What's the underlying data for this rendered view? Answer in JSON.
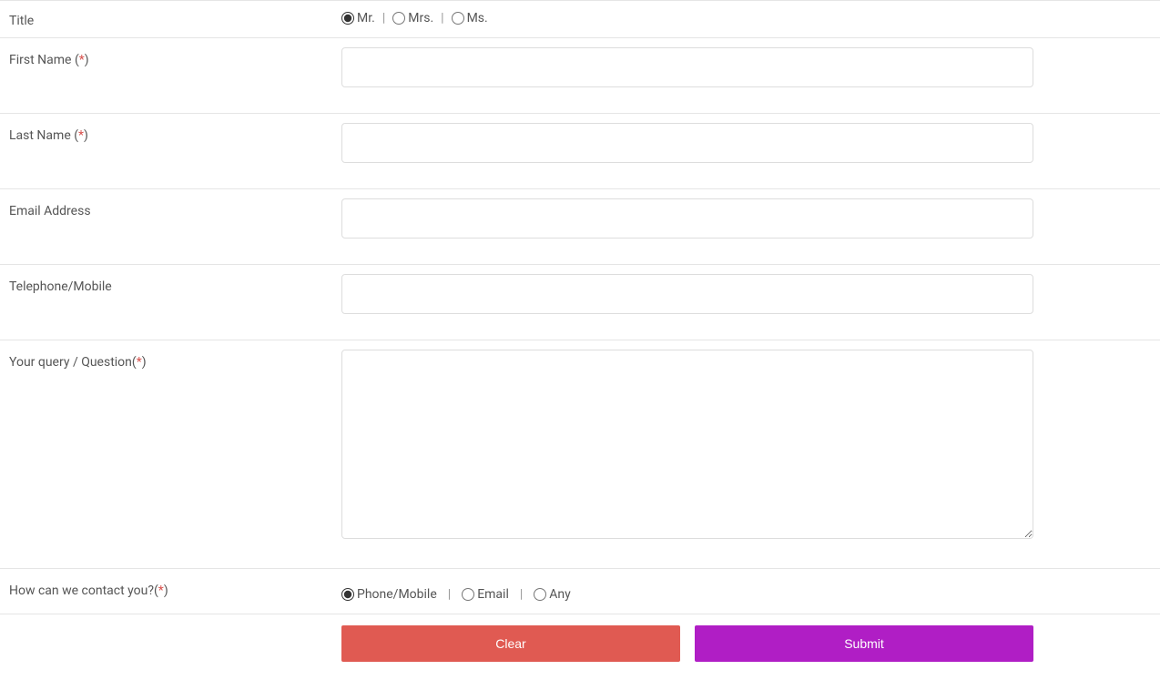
{
  "fields": {
    "title": {
      "label": "Title",
      "options": {
        "mr": "Mr.",
        "mrs": "Mrs.",
        "ms": "Ms."
      },
      "separator": "|"
    },
    "firstName": {
      "label": "First Name (",
      "required": "*",
      "closeParen": ")",
      "value": ""
    },
    "lastName": {
      "label": "Last Name (",
      "required": "*",
      "closeParen": ")",
      "value": ""
    },
    "email": {
      "label": "Email Address",
      "value": ""
    },
    "telephone": {
      "label": "Telephone/Mobile",
      "value": ""
    },
    "query": {
      "label": "Your query / Question(",
      "required": "*",
      "closeParen": ")",
      "value": ""
    },
    "contact": {
      "label": "How can we contact you?(",
      "required": "*",
      "closeParen": ")",
      "options": {
        "phone": "Phone/Mobile",
        "email": "Email",
        "any": "Any"
      },
      "separator": "|"
    }
  },
  "buttons": {
    "clear": "Clear",
    "submit": "Submit"
  }
}
